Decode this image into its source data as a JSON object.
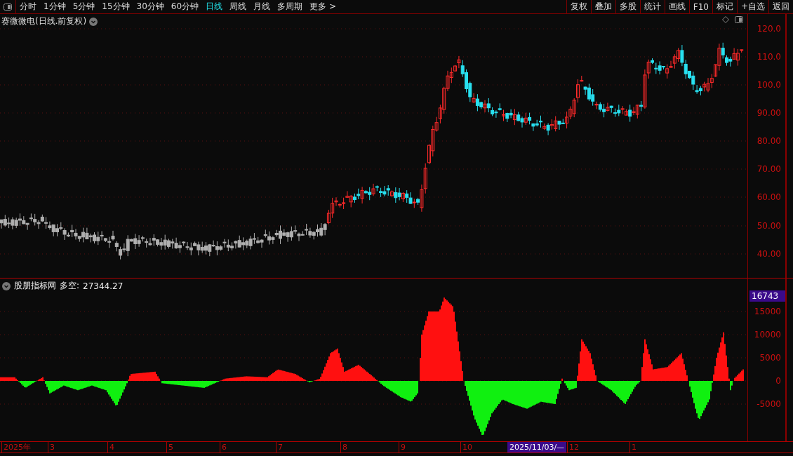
{
  "toolbar": {
    "periods": [
      {
        "label": "分时",
        "selected": false
      },
      {
        "label": "1分钟",
        "selected": false
      },
      {
        "label": "5分钟",
        "selected": false
      },
      {
        "label": "15分钟",
        "selected": false
      },
      {
        "label": "30分钟",
        "selected": false
      },
      {
        "label": "60分钟",
        "selected": false
      },
      {
        "label": "日线",
        "selected": true
      },
      {
        "label": "周线",
        "selected": false
      },
      {
        "label": "月线",
        "selected": false
      },
      {
        "label": "多周期",
        "selected": false
      },
      {
        "label": "更多 >",
        "selected": false
      }
    ],
    "buttons": [
      "复权",
      "叠加",
      "多股",
      "统计",
      "画线",
      "F10",
      "标记",
      "+自选",
      "返回"
    ]
  },
  "price_panel": {
    "title": "赛微微电(日线.前复权)",
    "axis_labels": [
      "120.0",
      "110.0",
      "100.0",
      "90.00",
      "80.00",
      "70.00",
      "60.00",
      "50.00",
      "40.00"
    ]
  },
  "indicator_panel": {
    "name": "股朋指标网",
    "label": "多空:",
    "value": "27344.27",
    "current_value": "16743",
    "axis_labels": [
      "15000",
      "10000",
      "5000",
      "0",
      "-5000"
    ]
  },
  "date_axis": {
    "labels": [
      "2025年",
      "3",
      "4",
      "5",
      "6",
      "7",
      "8",
      "9",
      "10",
      "12",
      "1"
    ],
    "cursor_label": "2025/11/03/—"
  }
}
